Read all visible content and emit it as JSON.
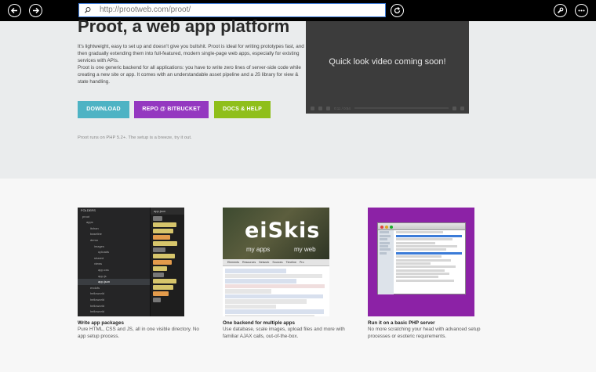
{
  "browser": {
    "url": "http://prootweb.com/proot/",
    "back_icon": "back-arrow-icon",
    "forward_icon": "forward-arrow-icon",
    "refresh_icon": "refresh-icon",
    "tools_icon": "wrench-icon",
    "more_icon": "more-icon"
  },
  "hero": {
    "title": "Proot, a web app platform",
    "intro_1": "It's lightweight, easy to set up and doesn't give you bullshit. Proot is ideal for writing prototypes fast, and then gradually extending them into full-featured, modern single-page web apps, especially for existing services with APIs.",
    "intro_2": "Proot is one generic backend for all applications: you have to write zero lines of server-side code while creating a new site or app. It comes with an understandable asset pipeline and a JS library for view & state handling.",
    "buttons": {
      "download": "DOWNLOAD",
      "repo": "REPO @ BITBUCKET",
      "docs": "DOCS & HELP"
    },
    "note": "Proot runs on PHP 5.2+. The setup is a breeze, try it out.",
    "video_text": "Quick look video coming soon!",
    "video_time": "0:11 / 0:54"
  },
  "features": [
    {
      "title": "Write app packages",
      "desc": "Pure HTML, CSS and JS, all in one visible directory. No app setup process."
    },
    {
      "title": "One backend for multiple apps",
      "desc": "Use database, scale images, upload files and more with familiar AJAX calls, out-of-the-box."
    },
    {
      "title": "Run it on a basic PHP server",
      "desc": "No more scratching your head with advanced setup processes or esoteric requirements."
    }
  ],
  "thumb_editor": {
    "header": "FOLDERS",
    "tab": "app.json",
    "tree": [
      "proot",
      "apps",
      "itchan",
      "baseline",
      "demo",
      "images",
      "uploads",
      "shared",
      "views",
      "app.css",
      "app.js",
      "app.json",
      "endofs",
      "helloworld",
      "helloworld",
      "helloworld",
      "helloworld"
    ]
  },
  "thumb_devtools": {
    "logo": "eiSkis",
    "sub_1": "my apps",
    "sub_2": "my web",
    "tabs": [
      "Elements",
      "Resources",
      "Network",
      "Sources",
      "Timeline",
      "Pro"
    ]
  },
  "colors": {
    "download": "#4eb3c4",
    "repo": "#9438c0",
    "docs": "#8fbf1b",
    "thumb_purple": "#8c22a6"
  }
}
